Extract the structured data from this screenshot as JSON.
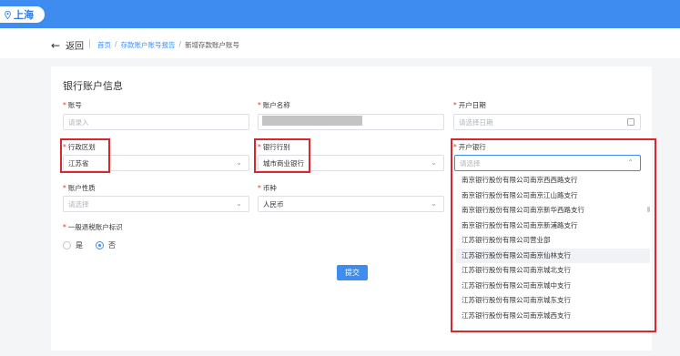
{
  "topbar": {
    "city": "上海",
    "city_icon": "location-pin-icon"
  },
  "nav": {
    "back_label": "返回",
    "breadcrumbs": [
      "首页",
      "存款账户账号报告",
      "新增存款账户账号"
    ],
    "breadcrumb_sep": "/"
  },
  "form": {
    "title": "银行账户信息",
    "account_no": {
      "label": "账号",
      "placeholder": "请录入"
    },
    "account_name": {
      "label": "账户名称"
    },
    "open_date": {
      "label": "开户日期",
      "placeholder": "请选择日期"
    },
    "region": {
      "label": "行政区划",
      "value": "江苏省"
    },
    "bank_type": {
      "label": "银行行别",
      "value": "城市商业银行"
    },
    "open_bank": {
      "label": "开户银行",
      "placeholder": "请选择"
    },
    "account_nature": {
      "label": "账户性质",
      "placeholder": "请选择"
    },
    "currency": {
      "label": "币种",
      "value": "人民币"
    },
    "general_deposit": {
      "label": "一般退税账户标识",
      "options": [
        "是",
        "否"
      ],
      "selected": "否"
    },
    "submit_label": "提交"
  },
  "dropdown": {
    "options": [
      "南京银行股份有限公司南京西西路支行",
      "南京银行股份有限公司南京江山路支行",
      "南京银行股份有限公司南京新华西路支行",
      "南京银行股份有限公司南京新浦路支行",
      "江苏银行股份有限公司营业部",
      "江苏银行股份有限公司南京仙林支行",
      "江苏银行股份有限公司南京城北支行",
      "江苏银行股份有限公司南京城中支行",
      "江苏银行股份有限公司南京城东支行",
      "江苏银行股份有限公司南京城西支行"
    ],
    "highlighted_index": 5
  },
  "colors": {
    "accent": "#3f8cf0",
    "required": "#e0312f",
    "annotation": "#d9272d"
  }
}
